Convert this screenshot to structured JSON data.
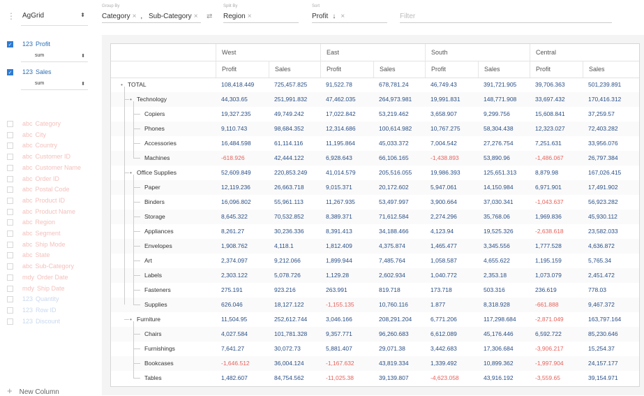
{
  "toolbar": {
    "renderer": "AgGrid",
    "group_by_caption": "Group By",
    "group_by": [
      "Category",
      "Sub-Category"
    ],
    "split_by_caption": "Split By",
    "split_by": [
      "Region"
    ],
    "sort_caption": "Sort",
    "sort_field": "Profit",
    "filter_placeholder": "Filter"
  },
  "sidebar": {
    "active_columns": [
      {
        "type": "123",
        "name": "Profit",
        "aggregate": "sum"
      },
      {
        "type": "123",
        "name": "Sales",
        "aggregate": "sum"
      }
    ],
    "inactive_columns": [
      {
        "type": "abc",
        "name": "Category"
      },
      {
        "type": "abc",
        "name": "City"
      },
      {
        "type": "abc",
        "name": "Country"
      },
      {
        "type": "abc",
        "name": "Customer ID"
      },
      {
        "type": "abc",
        "name": "Customer Name"
      },
      {
        "type": "abc",
        "name": "Order ID"
      },
      {
        "type": "abc",
        "name": "Postal Code"
      },
      {
        "type": "abc",
        "name": "Product ID"
      },
      {
        "type": "abc",
        "name": "Product Name"
      },
      {
        "type": "abc",
        "name": "Region"
      },
      {
        "type": "abc",
        "name": "Segment"
      },
      {
        "type": "abc",
        "name": "Ship Mode"
      },
      {
        "type": "abc",
        "name": "State"
      },
      {
        "type": "abc",
        "name": "Sub-Category"
      },
      {
        "type": "mdy",
        "name": "Order Date"
      },
      {
        "type": "mdy",
        "name": "Ship Date"
      },
      {
        "type": "123",
        "name": "Quantity"
      },
      {
        "type": "123",
        "name": "Row ID"
      },
      {
        "type": "123",
        "name": "Discount"
      }
    ],
    "new_column_label": "New Column"
  },
  "grid": {
    "regions": [
      "West",
      "East",
      "South",
      "Central"
    ],
    "measures": [
      "Profit",
      "Sales"
    ],
    "rows": [
      {
        "label": "TOTAL",
        "level": 0,
        "values": [
          "108,418.449",
          "725,457.825",
          "91,522.78",
          "678,781.24",
          "46,749.43",
          "391,721.905",
          "39,706.363",
          "501,239.891"
        ]
      },
      {
        "label": "Technology",
        "level": 1,
        "values": [
          "44,303.65",
          "251,991.832",
          "47,462.035",
          "264,973.981",
          "19,991.831",
          "148,771.908",
          "33,697.432",
          "170,416.312"
        ]
      },
      {
        "label": "Copiers",
        "level": 2,
        "values": [
          "19,327.235",
          "49,749.242",
          "17,022.842",
          "53,219.462",
          "3,658.907",
          "9,299.756",
          "15,608.841",
          "37,259.57"
        ]
      },
      {
        "label": "Phones",
        "level": 2,
        "values": [
          "9,110.743",
          "98,684.352",
          "12,314.686",
          "100,614.982",
          "10,767.275",
          "58,304.438",
          "12,323.027",
          "72,403.282"
        ]
      },
      {
        "label": "Accessories",
        "level": 2,
        "values": [
          "16,484.598",
          "61,114.116",
          "11,195.864",
          "45,033.372",
          "7,004.542",
          "27,276.754",
          "7,251.631",
          "33,956.076"
        ]
      },
      {
        "label": "Machines",
        "level": 2,
        "values": [
          "-618.926",
          "42,444.122",
          "6,928.643",
          "66,106.165",
          "-1,438.893",
          "53,890.96",
          "-1,486.067",
          "26,797.384"
        ]
      },
      {
        "label": "Office Supplies",
        "level": 1,
        "values": [
          "52,609.849",
          "220,853.249",
          "41,014.579",
          "205,516.055",
          "19,986.393",
          "125,651.313",
          "8,879.98",
          "167,026.415"
        ]
      },
      {
        "label": "Paper",
        "level": 2,
        "values": [
          "12,119.236",
          "26,663.718",
          "9,015.371",
          "20,172.602",
          "5,947.061",
          "14,150.984",
          "6,971.901",
          "17,491.902"
        ]
      },
      {
        "label": "Binders",
        "level": 2,
        "values": [
          "16,096.802",
          "55,961.113",
          "11,267.935",
          "53,497.997",
          "3,900.664",
          "37,030.341",
          "-1,043.637",
          "56,923.282"
        ]
      },
      {
        "label": "Storage",
        "level": 2,
        "values": [
          "8,645.322",
          "70,532.852",
          "8,389.371",
          "71,612.584",
          "2,274.296",
          "35,768.06",
          "1,969.836",
          "45,930.112"
        ]
      },
      {
        "label": "Appliances",
        "level": 2,
        "values": [
          "8,261.27",
          "30,236.336",
          "8,391.413",
          "34,188.466",
          "4,123.94",
          "19,525.326",
          "-2,638.618",
          "23,582.033"
        ]
      },
      {
        "label": "Envelopes",
        "level": 2,
        "values": [
          "1,908.762",
          "4,118.1",
          "1,812.409",
          "4,375.874",
          "1,465.477",
          "3,345.556",
          "1,777.528",
          "4,636.872"
        ]
      },
      {
        "label": "Art",
        "level": 2,
        "values": [
          "2,374.097",
          "9,212.066",
          "1,899.944",
          "7,485.764",
          "1,058.587",
          "4,655.622",
          "1,195.159",
          "5,765.34"
        ]
      },
      {
        "label": "Labels",
        "level": 2,
        "values": [
          "2,303.122",
          "5,078.726",
          "1,129.28",
          "2,602.934",
          "1,040.772",
          "2,353.18",
          "1,073.079",
          "2,451.472"
        ]
      },
      {
        "label": "Fasteners",
        "level": 2,
        "values": [
          "275.191",
          "923.216",
          "263.991",
          "819.718",
          "173.718",
          "503.316",
          "236.619",
          "778.03"
        ]
      },
      {
        "label": "Supplies",
        "level": 2,
        "values": [
          "626.046",
          "18,127.122",
          "-1,155.135",
          "10,760.116",
          "1.877",
          "8,318.928",
          "-661.888",
          "9,467.372"
        ]
      },
      {
        "label": "Furniture",
        "level": 1,
        "values": [
          "11,504.95",
          "252,612.744",
          "3,046.166",
          "208,291.204",
          "6,771.206",
          "117,298.684",
          "-2,871.049",
          "163,797.164"
        ]
      },
      {
        "label": "Chairs",
        "level": 2,
        "values": [
          "4,027.584",
          "101,781.328",
          "9,357.771",
          "96,260.683",
          "6,612.089",
          "45,176.446",
          "6,592.722",
          "85,230.646"
        ]
      },
      {
        "label": "Furnishings",
        "level": 2,
        "values": [
          "7,641.27",
          "30,072.73",
          "5,881.407",
          "29,071.38",
          "3,442.683",
          "17,306.684",
          "-3,906.217",
          "15,254.37"
        ]
      },
      {
        "label": "Bookcases",
        "level": 2,
        "values": [
          "-1,646.512",
          "36,004.124",
          "-1,167.632",
          "43,819.334",
          "1,339.492",
          "10,899.362",
          "-1,997.904",
          "24,157.177"
        ]
      },
      {
        "label": "Tables",
        "level": 2,
        "values": [
          "1,482.607",
          "84,754.562",
          "-11,025.38",
          "39,139.807",
          "-4,623.058",
          "43,916.192",
          "-3,559.65",
          "39,154.971"
        ]
      }
    ]
  }
}
